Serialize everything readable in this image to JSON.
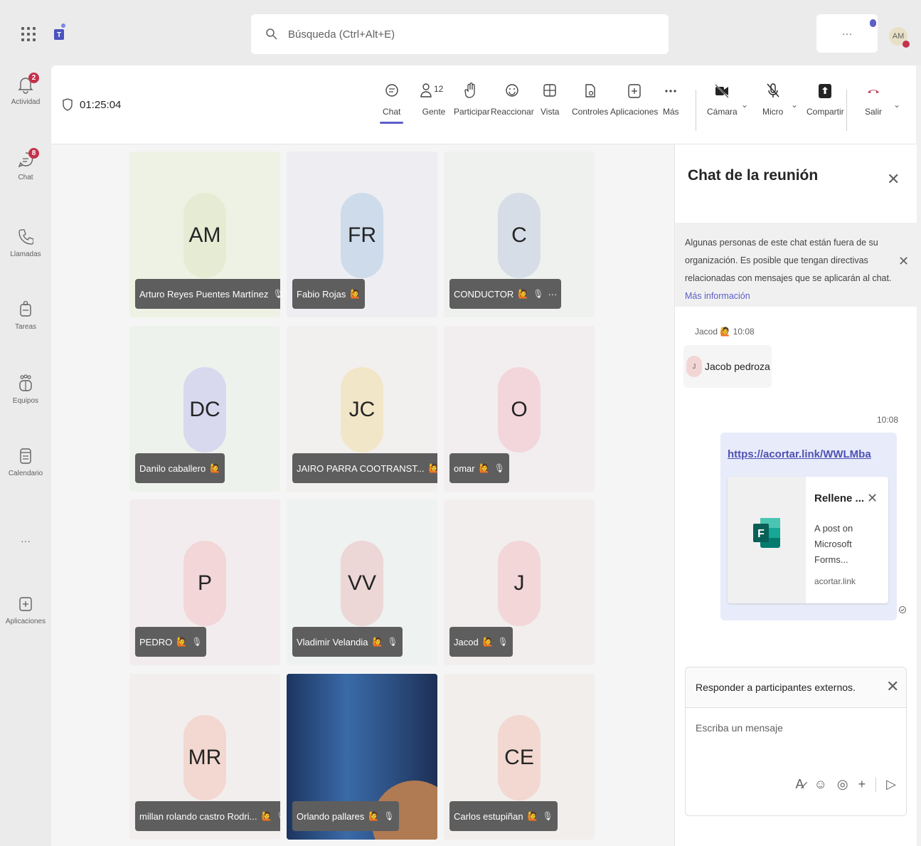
{
  "topbar": {
    "search_placeholder": "Búsqueda (Ctrl+Alt+E)",
    "more_label": "···",
    "avatar_initials": "AM"
  },
  "rail": {
    "items": [
      {
        "label": "Actividad",
        "icon": "bell-icon",
        "badge": "2"
      },
      {
        "label": "Chat",
        "icon": "chat-icon",
        "badge": "8"
      },
      {
        "label": "Llamadas",
        "icon": "phone-icon",
        "badge": ""
      },
      {
        "label": "Tareas",
        "icon": "tasks-icon",
        "badge": ""
      },
      {
        "label": "Equipos",
        "icon": "teams-icon",
        "badge": ""
      },
      {
        "label": "Calendario",
        "icon": "calendar-icon",
        "badge": ""
      },
      {
        "label": "···",
        "icon": "more-icon",
        "badge": ""
      },
      {
        "label": "Aplicaciones",
        "icon": "apps-icon",
        "badge": ""
      }
    ]
  },
  "meeting": {
    "timer": "01:25:04",
    "toolbar": {
      "chat": "Chat",
      "people": "Gente",
      "people_count": "12",
      "raise": "Participar",
      "react": "Reaccionar",
      "view": "Vista",
      "controls": "Controles",
      "apps": "Aplicaciones",
      "more": "Más",
      "camera": "Cámara",
      "mic": "Micro",
      "share": "Compartir",
      "leave": "Salir"
    }
  },
  "participants": [
    {
      "initials": "AM",
      "name": "Arturo Reyes Puentes Martínez",
      "bg": "#eef2e4",
      "circle": "#e6ecd4"
    },
    {
      "initials": "FR",
      "name": "Fabio Rojas",
      "bg": "#eeeef2",
      "circle": "#cddbea"
    },
    {
      "initials": "C",
      "name": "CONDUCTOR",
      "bg": "#eef1ee",
      "circle": "#d6dde6"
    },
    {
      "initials": "DC",
      "name": "Danilo caballero",
      "bg": "#eef2ec",
      "circle": "#d8d8ee"
    },
    {
      "initials": "JC",
      "name": "JAIRO PARRA COOTRANST...",
      "bg": "#f2f0ee",
      "circle": "#f2e6c8"
    },
    {
      "initials": "O",
      "name": "omar",
      "bg": "#f2eef0",
      "circle": "#f2d6dc"
    },
    {
      "initials": "P",
      "name": "PEDRO",
      "bg": "#f2ecee",
      "circle": "#f2d6d8"
    },
    {
      "initials": "VV",
      "name": "Vladimir Velandia",
      "bg": "#eef2f0",
      "circle": "#ecd6d6"
    },
    {
      "initials": "J",
      "name": "Jacod",
      "bg": "#f2eeee",
      "circle": "#f2d6d8"
    },
    {
      "initials": "MR",
      "name": "millan rolando castro Rodri...",
      "bg": "#f2eeee",
      "circle": "#f2d8d0"
    },
    {
      "initials": "",
      "name": "Orlando pallares",
      "bg": "#2a4a78",
      "circle": ""
    },
    {
      "initials": "CE",
      "name": "Carlos estupiñan",
      "bg": "#f2eeec",
      "circle": "#f2d8d0"
    }
  ],
  "chat": {
    "title": "Chat de la reunión",
    "banner_text": "Algunas personas de este chat están fuera de su organización. Es posible que tengan directivas relacionadas con mensajes que se aplicarán al chat.",
    "banner_link": "Más información",
    "msg1": {
      "author": "Jacod",
      "time": "10:08",
      "text": "Jacob pedroza",
      "avatar": "J"
    },
    "msg2": {
      "time": "10:08",
      "link": "https://acortar.link/WWLMba",
      "card_title": "Rellene ...",
      "card_desc": "A post on Microsoft Forms...",
      "card_domain": "acortar.link"
    },
    "compose": {
      "header": "Responder a participantes externos.",
      "placeholder": "Escriba un mensaje"
    }
  }
}
